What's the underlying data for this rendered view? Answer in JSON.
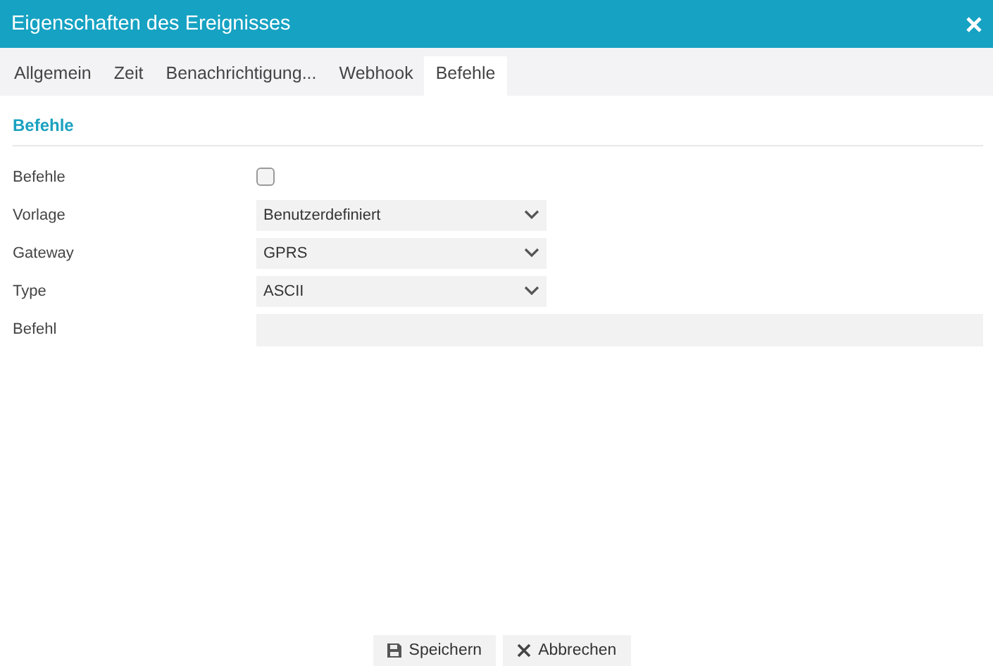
{
  "window": {
    "title": "Eigenschaften des Ereignisses"
  },
  "tabs": [
    {
      "label": "Allgemein",
      "selected": false
    },
    {
      "label": "Zeit",
      "selected": false
    },
    {
      "label": "Benachrichtigung...",
      "selected": false
    },
    {
      "label": "Webhook",
      "selected": false
    },
    {
      "label": "Befehle",
      "selected": true
    }
  ],
  "section": {
    "title": "Befehle"
  },
  "fields": [
    {
      "kind": "checkbox",
      "label": "Befehle",
      "checked": false
    },
    {
      "kind": "select",
      "label": "Vorlage",
      "value": "Benutzerdefiniert"
    },
    {
      "kind": "select",
      "label": "Gateway",
      "value": "GPRS"
    },
    {
      "kind": "select",
      "label": "Type",
      "value": "ASCII"
    },
    {
      "kind": "text",
      "label": "Befehl"
    }
  ],
  "buttons": [
    {
      "kind": "save",
      "label": "Speichern"
    },
    {
      "kind": "cancel",
      "label": "Abbrechen"
    }
  ]
}
